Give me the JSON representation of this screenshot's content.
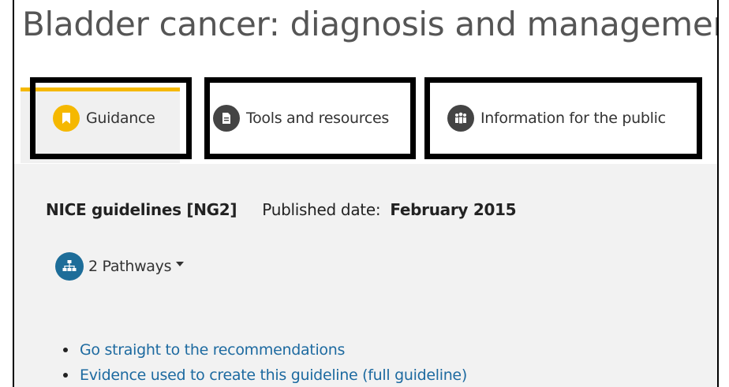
{
  "page": {
    "title": "Bladder cancer: diagnosis and management"
  },
  "tabs": [
    {
      "label": "Guidance",
      "icon": "bookmark-icon",
      "active": true
    },
    {
      "label": "Tools and resources",
      "icon": "document-icon",
      "active": false
    },
    {
      "label": "Information for the public",
      "icon": "people-icon",
      "active": false
    }
  ],
  "meta": {
    "guideline_label": "NICE guidelines [NG2]",
    "published_label": "Published date:",
    "published_date": "February 2015"
  },
  "pathways": {
    "label": "2 Pathways",
    "icon": "hierarchy-icon"
  },
  "links": [
    "Go straight to the recommendations",
    "Evidence used to create this guideline (full guideline)"
  ],
  "colors": {
    "accent": "#f5b800",
    "link": "#1d6aa0",
    "pathway_icon_bg": "#1d6d99",
    "panel_bg": "#f2f2f2",
    "tab_highlight_border": "#000000"
  }
}
